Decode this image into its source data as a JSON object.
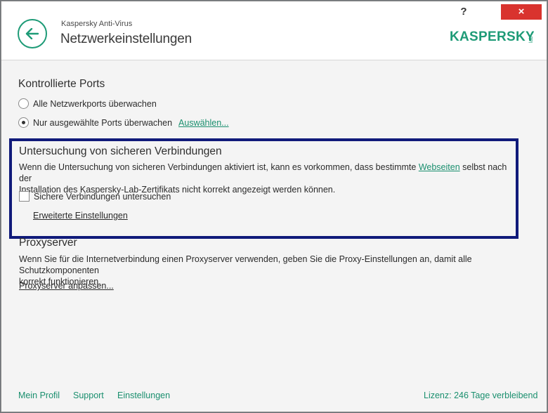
{
  "header": {
    "app_name": "Kaspersky Anti-Virus",
    "title": "Netzwerkeinstellungen",
    "help_label": "?",
    "close_label": "×",
    "logo_text": "KASPERSKY",
    "logo_sub": "lab",
    "accent_color": "#1e9b77"
  },
  "ports": {
    "title": "Kontrollierte Ports",
    "option_all": "Alle Netzwerkports überwachen",
    "option_selected": "Nur ausgewählte Ports überwachen",
    "select_link": "Auswählen...",
    "selected": "option_selected"
  },
  "secure": {
    "title": "Untersuchung von sicheren Verbindungen",
    "desc_part1": "Wenn die Untersuchung von sicheren Verbindungen aktiviert ist, kann es vorkommen, dass bestimmte ",
    "desc_link": "Webseiten",
    "desc_part2": " selbst nach der",
    "desc_line2": "Installation des Kaspersky-Lab-Zertifikats nicht korrekt angezeigt werden können.",
    "checkbox_label": "Sichere Verbindungen untersuchen",
    "checked": false,
    "advanced_link": "Erweiterte Einstellungen"
  },
  "proxy": {
    "title": "Proxyserver",
    "desc_line1": "Wenn Sie für die Internetverbindung einen Proxyserver verwenden, geben Sie die Proxy-Einstellungen an, damit alle Schutzkomponenten",
    "desc_line2": "korrekt funktionieren.",
    "configure_link": "Proxyserver anpassen..."
  },
  "footer": {
    "my_profile": "Mein Profil",
    "support": "Support",
    "settings": "Einstellungen",
    "license": "Lizenz: 246 Tage verbleibend"
  }
}
